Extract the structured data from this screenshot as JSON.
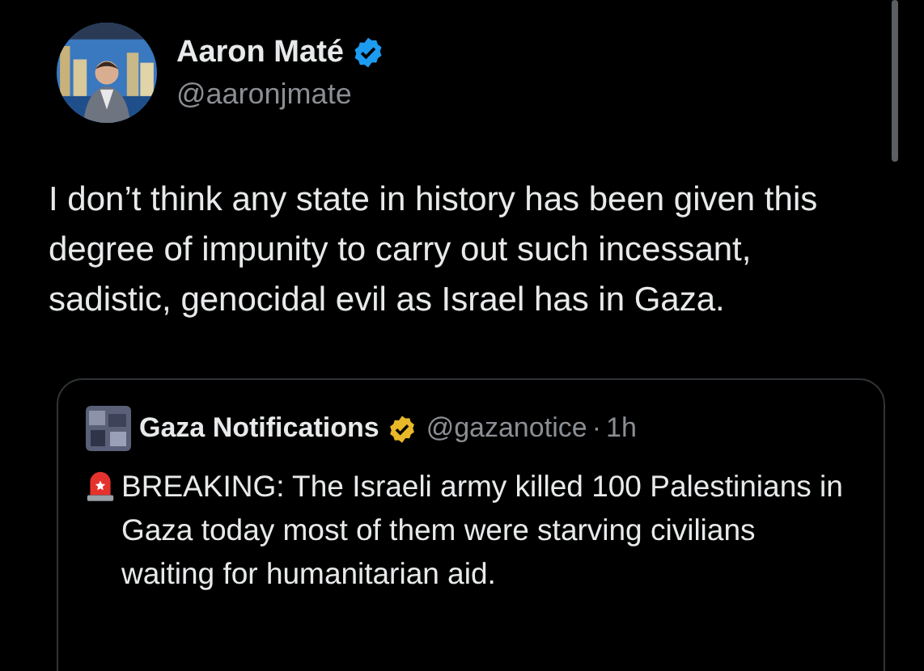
{
  "author": {
    "name": "Aaron Maté",
    "handle": "@aaronjmate",
    "verified": true
  },
  "text": "I don’t think any state in history has been given this degree of impunity to carry out such incessant, sadistic, genocidal evil as Israel has in Gaza.",
  "quoted": {
    "name": "Gaza Notifications",
    "verified": true,
    "handle": "@gazanotice",
    "separator": "·",
    "time": "1h",
    "text": "BREAKING: The Israeli army killed 100 Palestinians in Gaza today most of them were starving civilians waiting for humanitarian aid."
  }
}
